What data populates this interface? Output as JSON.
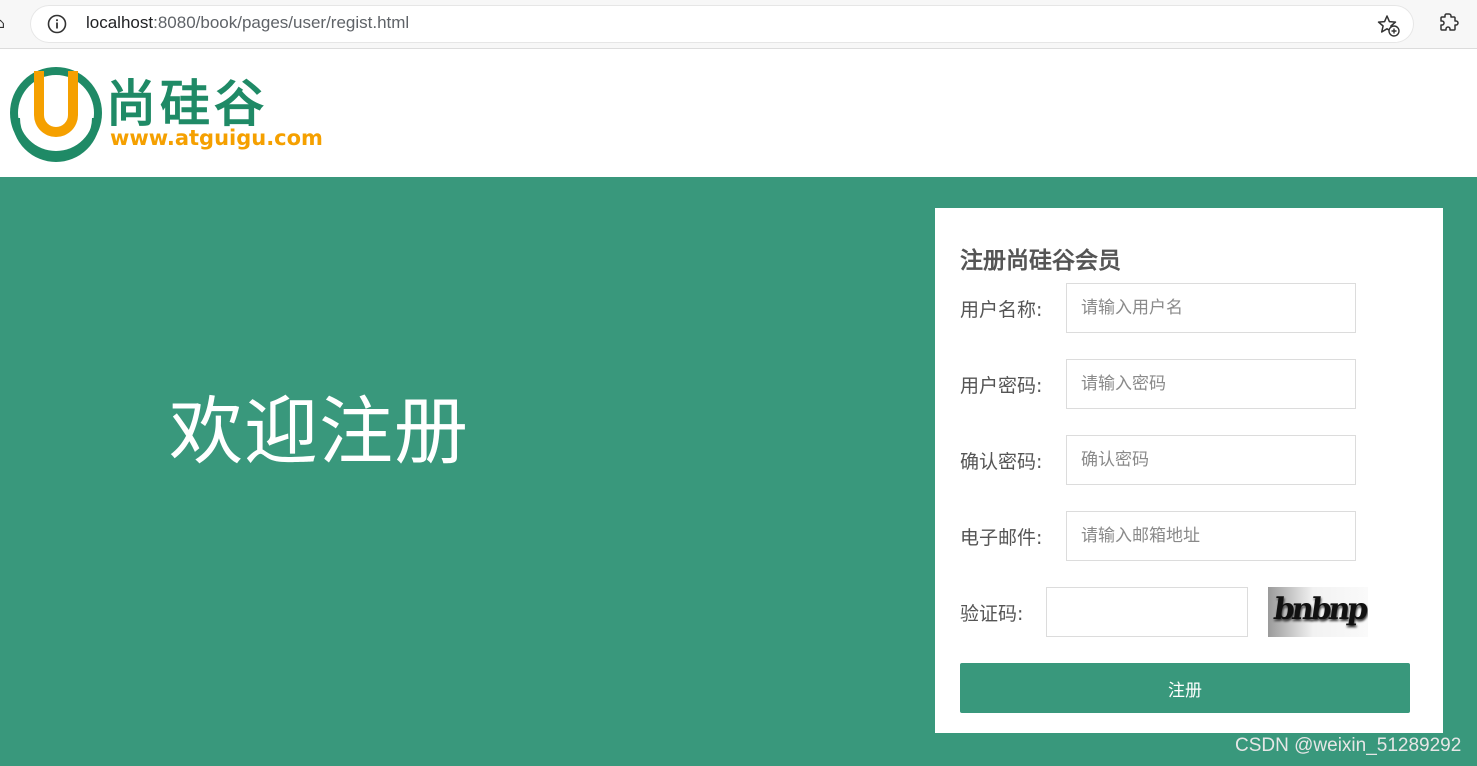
{
  "browser": {
    "url_host": "localhost",
    "url_path": ":8080/book/pages/user/regist.html",
    "icons": [
      "info-icon",
      "favorites-add-icon",
      "extensions-icon"
    ]
  },
  "header": {
    "logo_text_cn": "尚硅谷",
    "logo_text_url": "www.atguigu.com",
    "logo_letter": "U"
  },
  "main": {
    "welcome": "欢迎注册"
  },
  "form": {
    "title": "注册尚硅谷会员",
    "username_label": "用户名称:",
    "username_placeholder": "请输入用户名",
    "password_label": "用户密码:",
    "password_placeholder": "请输入密码",
    "confirm_label": "确认密码:",
    "confirm_placeholder": "确认密码",
    "email_label": "电子邮件:",
    "email_placeholder": "请输入邮箱地址",
    "captcha_label": "验证码:",
    "captcha_value": "",
    "captcha_image_text": "bnbnp",
    "submit_label": "注册"
  },
  "watermark": "CSDN @weixin_51289292",
  "colors": {
    "brand_green": "#39987c",
    "logo_orange": "#f5a000",
    "logo_green": "#1f8a66"
  }
}
